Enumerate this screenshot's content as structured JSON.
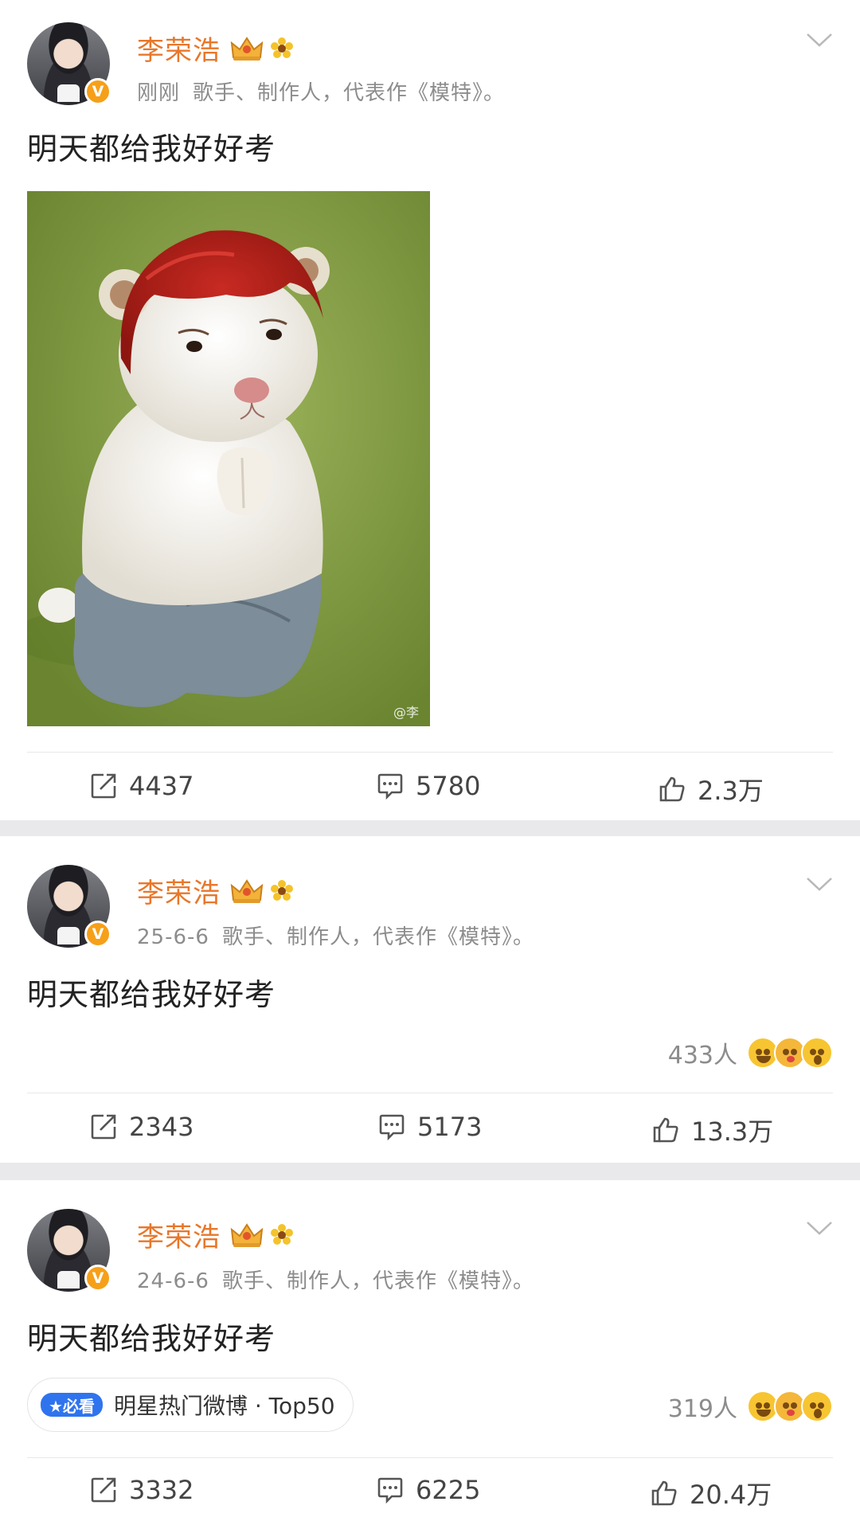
{
  "posts": [
    {
      "author": "李荣浩",
      "time": "刚刚",
      "bio": "歌手、制作人，代表作《模特》。",
      "text": "明天都给我好好考",
      "image_watermark": "@李",
      "reposts": "4437",
      "comments": "5780",
      "likes": "2.3万"
    },
    {
      "author": "李荣浩",
      "time": "25-6-6",
      "bio": "歌手、制作人，代表作《模特》。",
      "text": "明天都给我好好考",
      "reaction_count": "433人",
      "reposts": "2343",
      "comments": "5173",
      "likes": "13.3万"
    },
    {
      "author": "李荣浩",
      "time": "24-6-6",
      "bio": "歌手、制作人，代表作《模特》。",
      "text": "明天都给我好好考",
      "tag_badge": "★必看",
      "tag_text": "明星热门微博 · Top50",
      "reaction_count": "319人",
      "reposts": "3332",
      "comments": "6225",
      "likes": "20.4万"
    }
  ],
  "icons": {
    "avatar_badge": "V",
    "crown": "crown-icon",
    "flower": "sunflower-icon",
    "menu": "chevron-down-icon",
    "repost": "repost-icon",
    "comment": "comment-icon",
    "like": "thumbs-up-icon"
  },
  "colors": {
    "name": "#e8772a",
    "meta": "#8c8c8c",
    "badge_orange": "#f6a019",
    "tag_blue": "#2f74ee"
  }
}
